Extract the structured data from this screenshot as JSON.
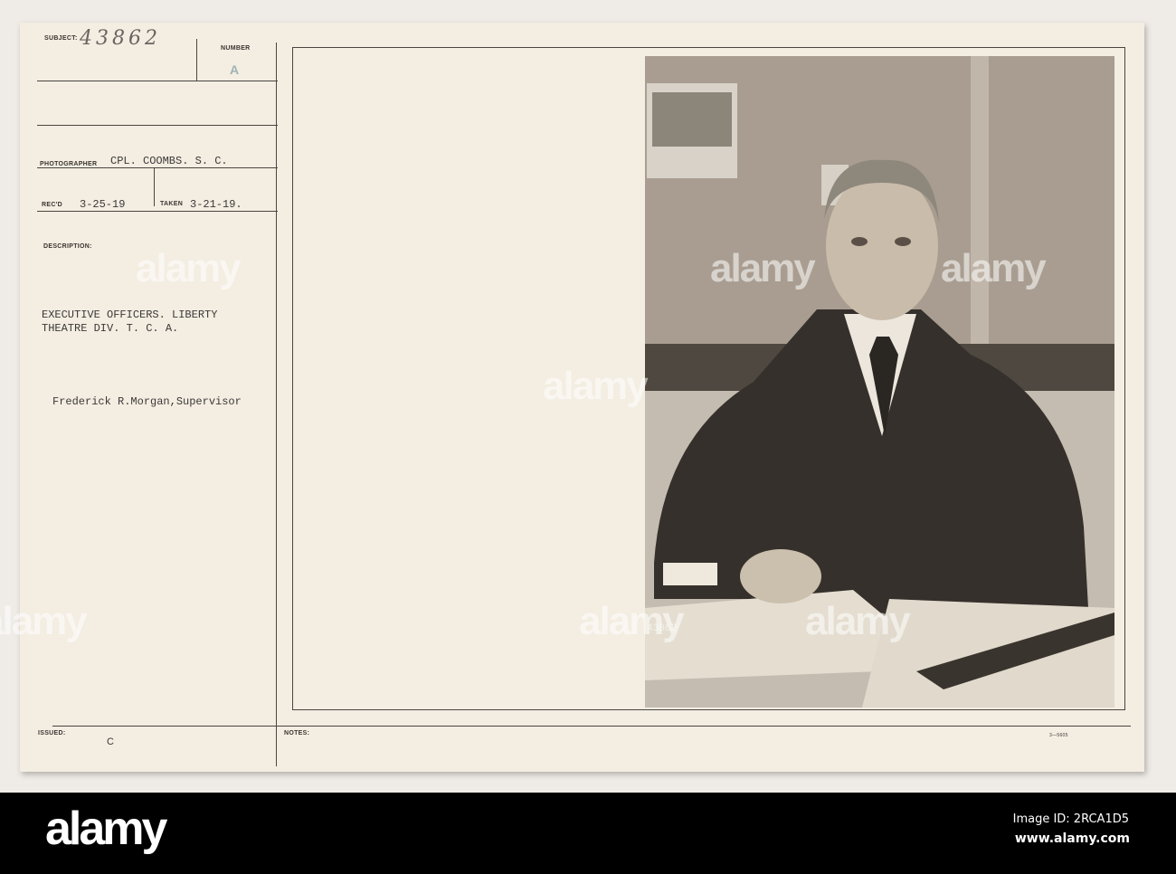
{
  "card": {
    "subject_label": "SUBJECT:",
    "subject_value": "43862",
    "number_label": "NUMBER",
    "number_value": "A",
    "photographer_label": "PHOTOGRAPHER",
    "photographer_value": "CPL. COOMBS. S. C.",
    "recd_label": "REC'D",
    "recd_value": "3-25-19",
    "taken_label": "TAKEN",
    "taken_value": "3-21-19.",
    "description_label": "DESCRIPTION:",
    "description_lines": [
      "EXECUTIVE OFFICERS. LIBERTY",
      "THEATRE DIV. T. C. A."
    ],
    "person_line": "Frederick R.Morgan,Supervisor",
    "issued_label": "ISSUED:",
    "issued_value": "C",
    "notes_label": "NOTES:",
    "form_number": "3—5605"
  },
  "photo": {
    "negative_number": "43862"
  },
  "watermark": {
    "text": "alamy",
    "logo": "alamy",
    "image_id": "Image ID: 2RCA1D5",
    "site": "www.alamy.com"
  }
}
